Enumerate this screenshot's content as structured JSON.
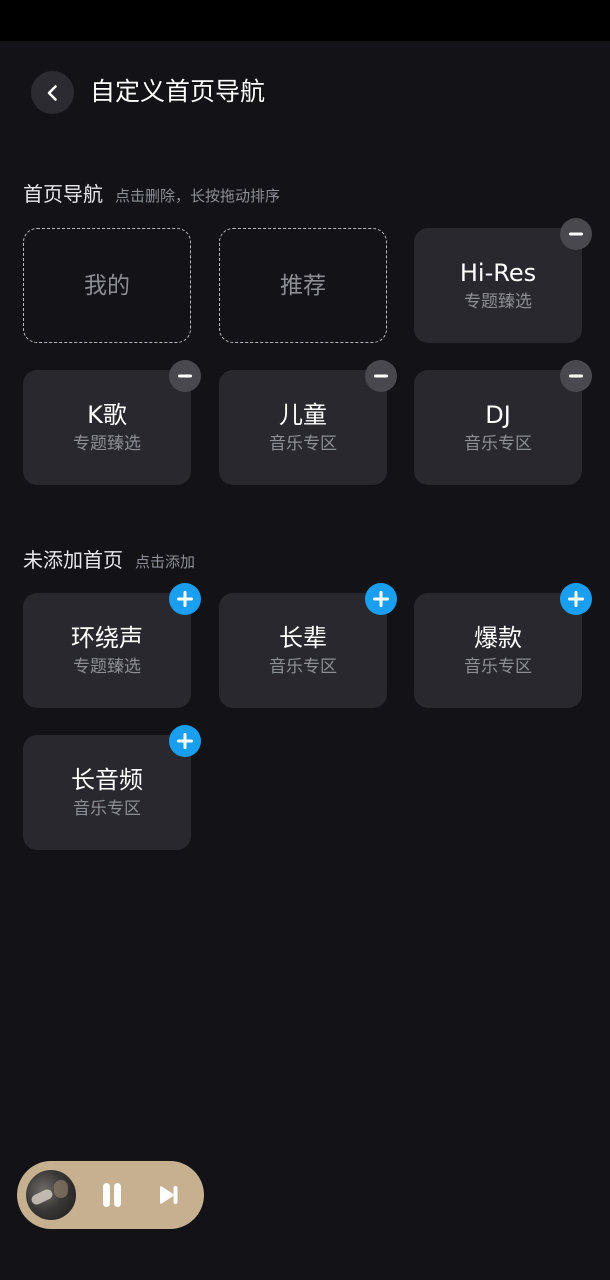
{
  "header": {
    "title": "自定义首页导航"
  },
  "home_nav": {
    "title": "首页导航",
    "hint": "点击删除，长按拖动排序",
    "fixed_items": [
      {
        "name": "我的"
      },
      {
        "name": "推荐"
      }
    ],
    "items": [
      {
        "name": "Hi-Res",
        "sub": "专题臻选"
      },
      {
        "name": "K歌",
        "sub": "专题臻选"
      },
      {
        "name": "儿童",
        "sub": "音乐专区"
      },
      {
        "name": "DJ",
        "sub": "音乐专区"
      }
    ]
  },
  "not_added": {
    "title": "未添加首页",
    "hint": "点击添加",
    "items": [
      {
        "name": "环绕声",
        "sub": "专题臻选"
      },
      {
        "name": "长辈",
        "sub": "音乐专区"
      },
      {
        "name": "爆款",
        "sub": "音乐专区"
      },
      {
        "name": "长音频",
        "sub": "音乐专区"
      }
    ]
  },
  "icons": {
    "back": "chevron-left-icon",
    "remove": "minus-icon",
    "add": "plus-icon",
    "pause": "pause-icon",
    "next": "skip-next-icon"
  },
  "colors": {
    "background": "#121217",
    "tile": "#28282e",
    "add_badge": "#1a9ff0",
    "remove_badge": "#48484e",
    "player": "#c6b08f"
  }
}
